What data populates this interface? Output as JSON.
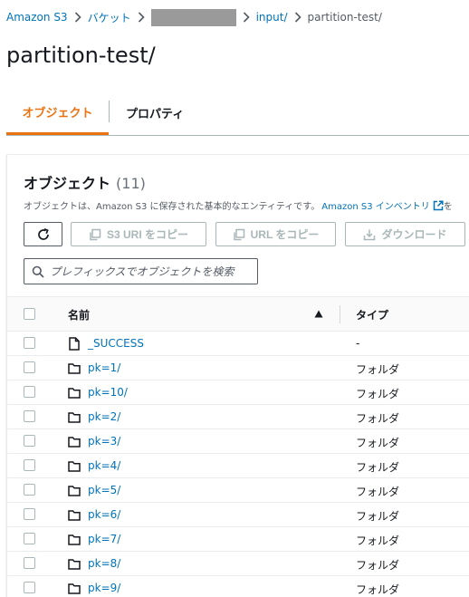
{
  "breadcrumb": {
    "items": [
      {
        "label": "Amazon S3"
      },
      {
        "label": "バケット"
      },
      {
        "label": ""
      },
      {
        "label": "input/"
      },
      {
        "label": "partition-test/"
      }
    ]
  },
  "page": {
    "title": "partition-test/"
  },
  "tabs": [
    {
      "label": "オブジェクト",
      "active": true
    },
    {
      "label": "プロパティ",
      "active": false
    }
  ],
  "objects_panel": {
    "title": "オブジェクト",
    "count": "(11)",
    "description": "オブジェクトは、Amazon S3 に保存された基本的なエンティティです。",
    "inventory_link": "Amazon S3 インベントリ",
    "description_tail": "を",
    "buttons": {
      "refresh_icon": "refresh-icon",
      "copy_s3_uri": "S3 URI をコピー",
      "copy_url": "URL をコピー",
      "download": "ダウンロード"
    },
    "search": {
      "placeholder": "プレフィックスでオブジェクトを検索"
    }
  },
  "table": {
    "columns": {
      "name": "名前",
      "type": "タイプ"
    },
    "sort": "ascending",
    "rows": [
      {
        "name": "_SUCCESS",
        "type": "-",
        "icon": "file-icon"
      },
      {
        "name": "pk=1/",
        "type": "フォルダ",
        "icon": "folder-icon"
      },
      {
        "name": "pk=10/",
        "type": "フォルダ",
        "icon": "folder-icon"
      },
      {
        "name": "pk=2/",
        "type": "フォルダ",
        "icon": "folder-icon"
      },
      {
        "name": "pk=3/",
        "type": "フォルダ",
        "icon": "folder-icon"
      },
      {
        "name": "pk=4/",
        "type": "フォルダ",
        "icon": "folder-icon"
      },
      {
        "name": "pk=5/",
        "type": "フォルダ",
        "icon": "folder-icon"
      },
      {
        "name": "pk=6/",
        "type": "フォルダ",
        "icon": "folder-icon"
      },
      {
        "name": "pk=7/",
        "type": "フォルダ",
        "icon": "folder-icon"
      },
      {
        "name": "pk=8/",
        "type": "フォルダ",
        "icon": "folder-icon"
      },
      {
        "name": "pk=9/",
        "type": "フォルダ",
        "icon": "folder-icon"
      }
    ]
  },
  "colors": {
    "link": "#0073bb",
    "active_tab": "#ec7211",
    "disabled": "#aab7b8",
    "text": "#16191f"
  }
}
